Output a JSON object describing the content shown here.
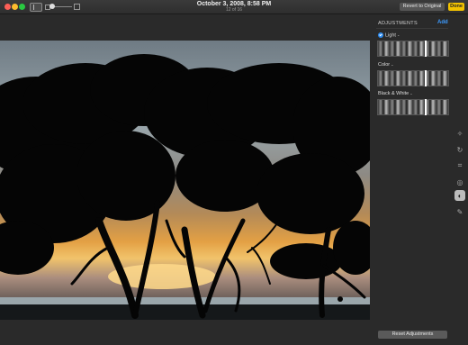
{
  "window": {
    "date_title": "October 3, 2008, 8:58 PM",
    "photo_counter": "12 of 16",
    "revert_label": "Revert to Original",
    "done_label": "Done"
  },
  "panel": {
    "title": "ADJUSTMENTS",
    "add_label": "Add",
    "sections": [
      {
        "label": "Light",
        "enabled": true
      },
      {
        "label": "Color",
        "enabled": false
      },
      {
        "label": "Black & White",
        "enabled": false
      }
    ],
    "reset_label": "Reset Adjustments"
  },
  "toolbar": {
    "tools": [
      "magic-wand-icon",
      "rotate-icon",
      "crop-icon",
      "filters-icon",
      "adjust-icon",
      "retouch-icon"
    ],
    "active_tool": "adjust-icon"
  },
  "colors": {
    "accent": "#3d9bff",
    "done": "#f2c200"
  }
}
